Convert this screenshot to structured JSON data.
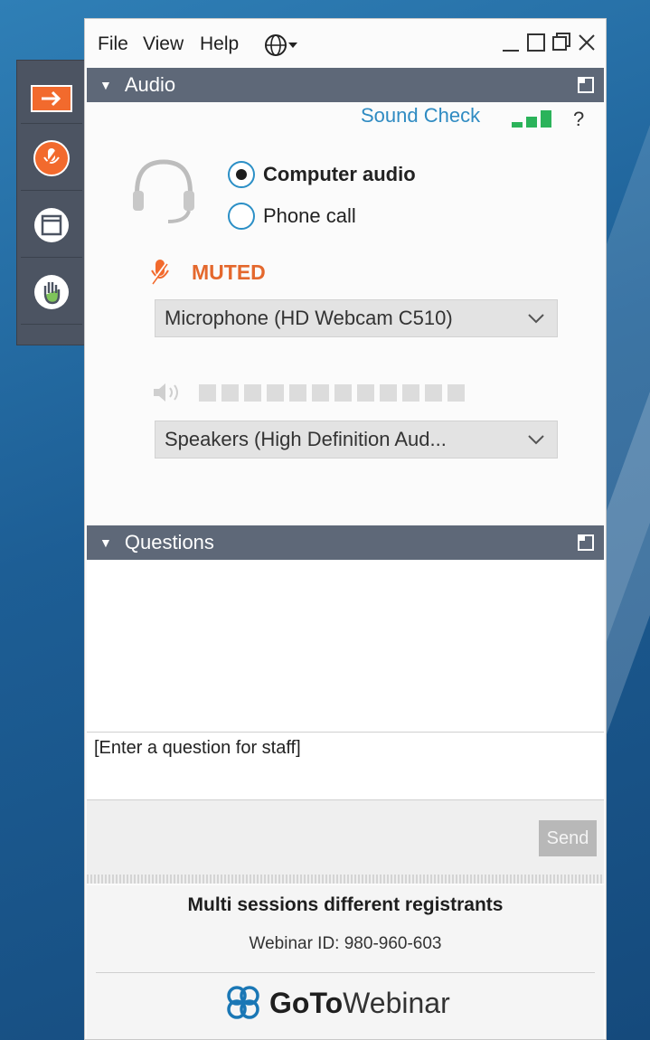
{
  "menu": {
    "file": "File",
    "view": "View",
    "help": "Help",
    "language_icon": "globe-icon"
  },
  "window_controls": {
    "minimize": "minimize-icon",
    "maximize": "maximize-icon",
    "restore": "restore-icon",
    "close": "close-icon"
  },
  "sidebar": {
    "items": [
      {
        "name": "collapse-panel",
        "icon": "arrow-right-icon"
      },
      {
        "name": "microphone-muted",
        "icon": "mic-muted-icon"
      },
      {
        "name": "screen",
        "icon": "window-icon"
      },
      {
        "name": "raise-hand",
        "icon": "hand-icon"
      }
    ],
    "colors": {
      "accent": "#f26a2d",
      "background": "#4c5462"
    }
  },
  "audio": {
    "header": "Audio",
    "sound_check": "Sound Check",
    "help": "?",
    "options": [
      {
        "label": "Computer audio",
        "selected": true
      },
      {
        "label": "Phone call",
        "selected": false
      }
    ],
    "status": "MUTED",
    "microphone": "Microphone (HD Webcam C510)",
    "speaker_level": 0,
    "speaker_segments": 12,
    "speakers": "Speakers (High Definition Aud..."
  },
  "questions": {
    "header": "Questions",
    "placeholder": "[Enter a question for staff]",
    "send": "Send"
  },
  "footer": {
    "title": "Multi sessions different registrants",
    "webinar_id": "Webinar ID: 980-960-603",
    "brand_bold": "GoTo",
    "brand_rest": "Webinar"
  },
  "colors": {
    "header_bar": "#5e6878",
    "link": "#2f8bc2",
    "muted": "#e4682d",
    "signal": "#2bb35a"
  }
}
